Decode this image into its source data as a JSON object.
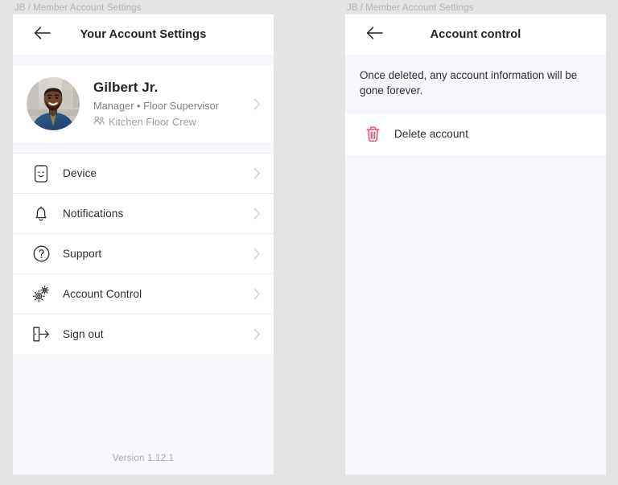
{
  "theme": {
    "page_bg": "#e4e4e4",
    "panel_bg": "#f6f7fa",
    "card_bg": "#ffffff",
    "text_primary": "#2b2f33",
    "text_muted": "#7d8286",
    "breadcrumb_color": "#b4b4b4",
    "divider": "#ececec",
    "chevron": "#c9cdd1",
    "danger": "#e8456f"
  },
  "left_panel": {
    "breadcrumb": {
      "root": "JB",
      "separator": "/",
      "current": "Member Account Settings"
    },
    "appbar": {
      "back_icon": "arrow-left-icon",
      "title": "Your Account Settings"
    },
    "profile": {
      "avatar_alt": "avatar",
      "name": "Gilbert Jr.",
      "role": "Manager • Floor Supervisor",
      "crew_icon": "people-icon",
      "crew": "Kitchen Floor Crew",
      "chevron_icon": "chevron-right-icon"
    },
    "menu": [
      {
        "id": "device",
        "icon": "phone-smiley-icon",
        "label": "Device",
        "chevron_icon": "chevron-right-icon"
      },
      {
        "id": "notifications",
        "icon": "bell-icon",
        "label": "Notifications",
        "chevron_icon": "chevron-right-icon"
      },
      {
        "id": "support",
        "icon": "question-circle-icon",
        "label": "Support",
        "chevron_icon": "chevron-right-icon"
      },
      {
        "id": "account-control",
        "icon": "gears-icon",
        "label": "Account Control",
        "chevron_icon": "chevron-right-icon"
      },
      {
        "id": "sign-out",
        "icon": "sign-out-icon",
        "label": "Sign out",
        "chevron_icon": "chevron-right-icon"
      }
    ],
    "version": "Version 1.12.1"
  },
  "right_panel": {
    "breadcrumb": {
      "root": "JB",
      "separator": "/",
      "current": "Member Account Settings"
    },
    "appbar": {
      "back_icon": "arrow-left-icon",
      "title": "Account control"
    },
    "notice": "Once deleted, any account information will be gone forever.",
    "delete_row": {
      "icon": "trash-icon",
      "label": "Delete account"
    }
  }
}
